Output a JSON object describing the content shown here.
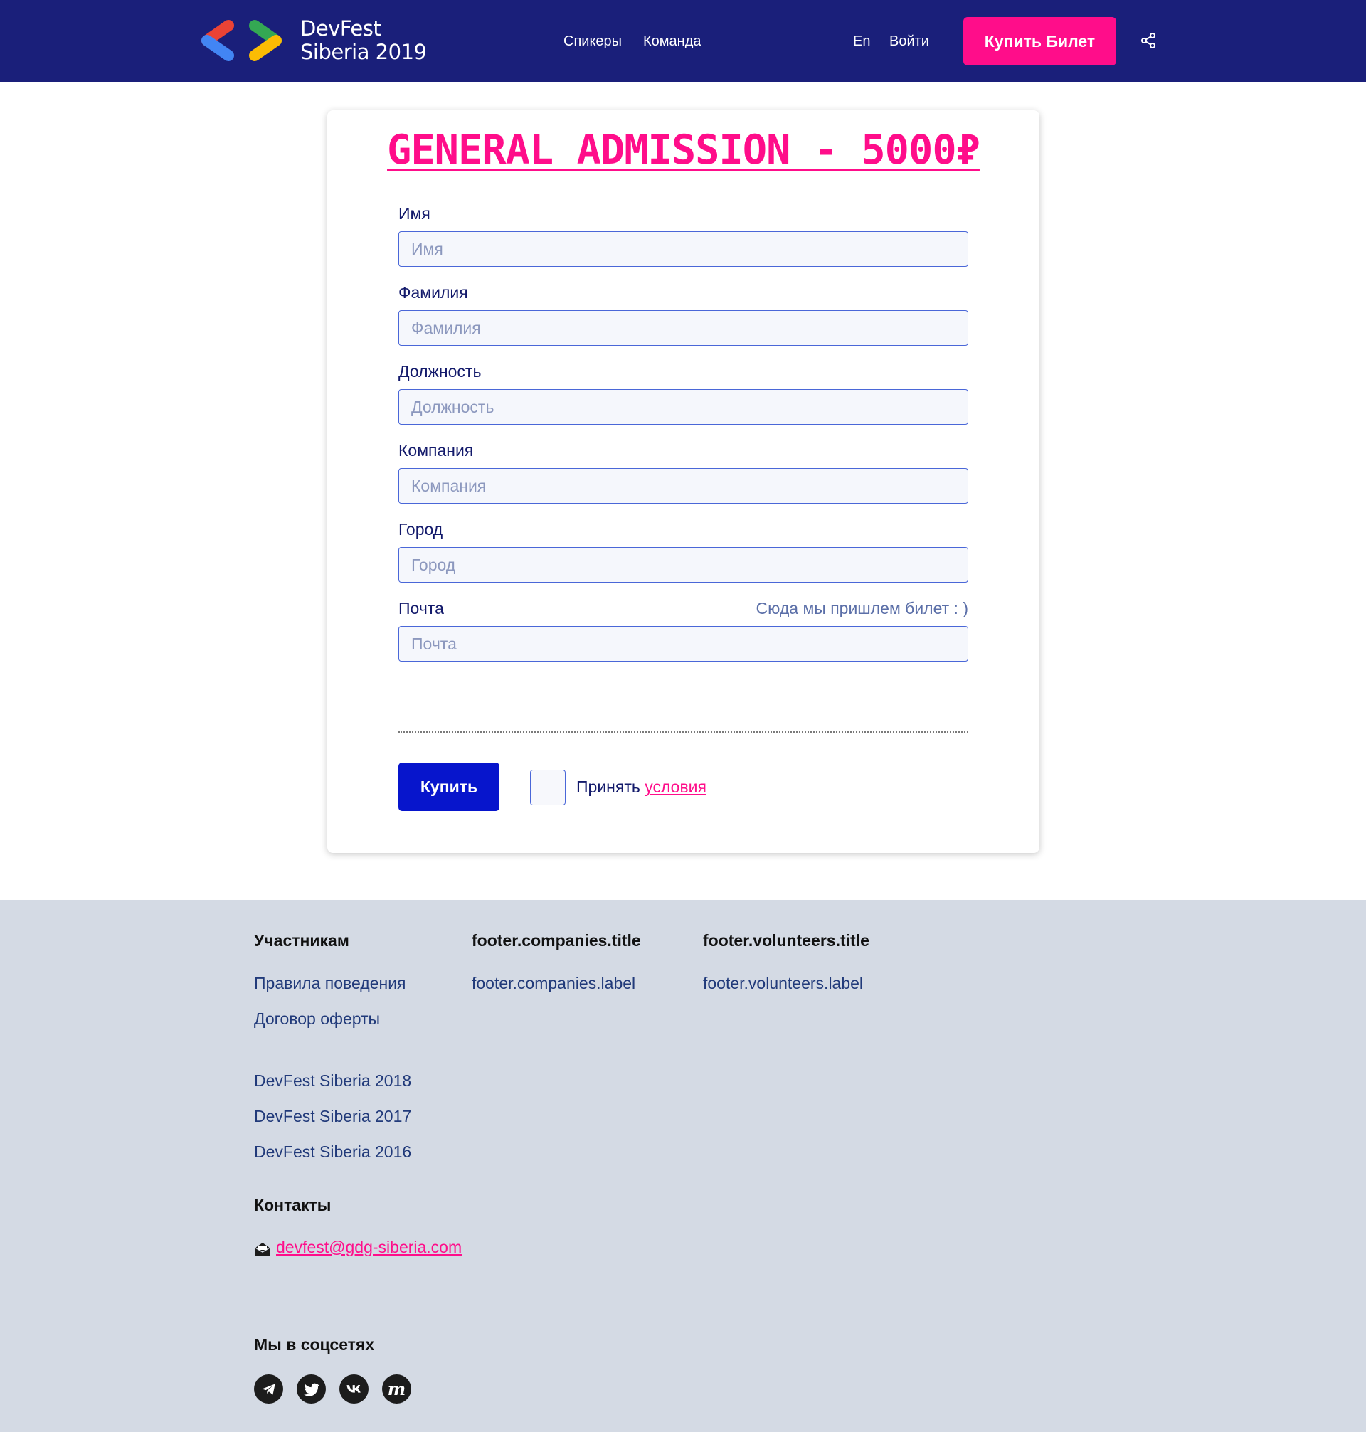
{
  "header": {
    "logo_line1": "DevFest",
    "logo_line2": "Siberia 2019",
    "nav": {
      "speakers": "Спикеры",
      "team": "Команда"
    },
    "lang": "En",
    "login": "Войти",
    "buy_ticket": "Купить Билет"
  },
  "form": {
    "title": "GENERAL ADMISSION - 5000₽",
    "fields": {
      "first_name": {
        "label": "Имя",
        "placeholder": "Имя",
        "value": ""
      },
      "last_name": {
        "label": "Фамилия",
        "placeholder": "Фамилия",
        "value": ""
      },
      "position": {
        "label": "Должность",
        "placeholder": "Должность",
        "value": ""
      },
      "company": {
        "label": "Компания",
        "placeholder": "Компания",
        "value": ""
      },
      "city": {
        "label": "Город",
        "placeholder": "Город",
        "value": ""
      },
      "email": {
        "label": "Почта",
        "placeholder": "Почта",
        "hint": "Сюда мы пришлем билет : )",
        "value": ""
      }
    },
    "buy_button": "Купить",
    "accept_prefix": "Принять",
    "accept_link": "условия",
    "accepted": false
  },
  "footer": {
    "participants": {
      "title": "Участникам",
      "links": [
        "Правила поведения",
        "Договор оферты"
      ]
    },
    "companies": {
      "title": "footer.companies.title",
      "label": "footer.companies.label"
    },
    "volunteers": {
      "title": "footer.volunteers.title",
      "label": "footer.volunteers.label"
    },
    "archive": [
      "DevFest Siberia 2018",
      "DevFest Siberia 2017",
      "DevFest Siberia 2016"
    ],
    "contacts": {
      "title": "Контакты",
      "email": "devfest@gdg-siberia.com"
    },
    "social": {
      "title": "Мы в соцсетях",
      "icons": [
        "telegram-icon",
        "twitter-icon",
        "vk-icon",
        "meetup-icon"
      ],
      "meetup_glyph": "m"
    }
  },
  "colors": {
    "header_bg": "#1a1f7a",
    "accent_pink": "#ff0d8a",
    "primary_blue": "#0715cc",
    "footer_bg": "#d4dae4"
  }
}
